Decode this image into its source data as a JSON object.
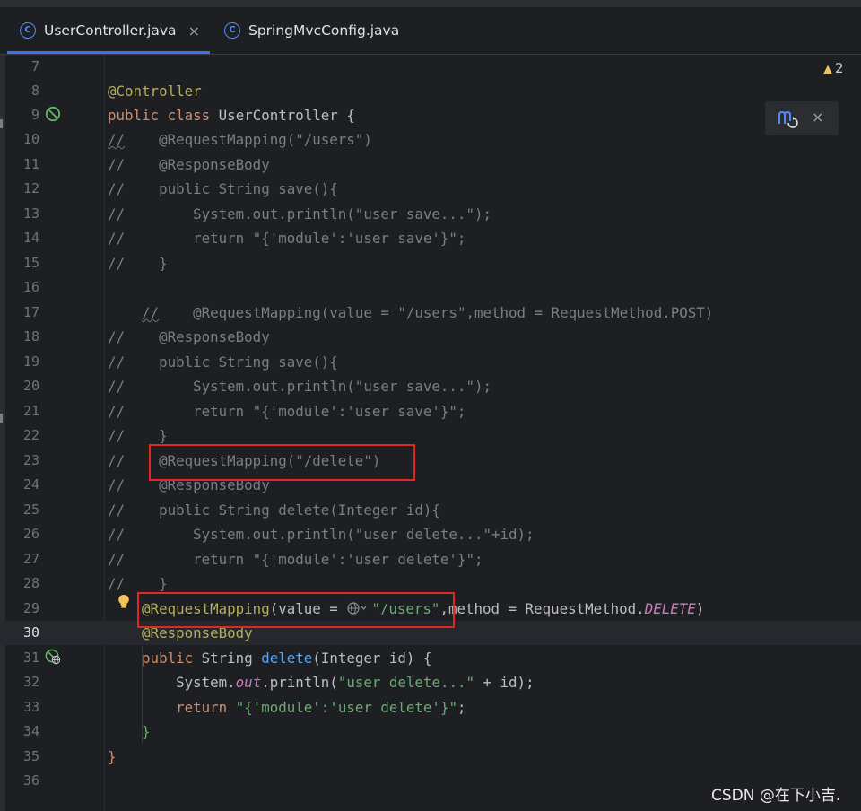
{
  "tabs": [
    {
      "label": "UserController.java",
      "icon": "class-icon",
      "icon_letter": "C",
      "active": true,
      "close_label": "×"
    },
    {
      "label": "SpringMvcConfig.java",
      "icon": "class-icon",
      "icon_letter": "C",
      "active": false
    }
  ],
  "warnings": {
    "icon": "warning-icon",
    "count": "2"
  },
  "maven_popup": {
    "icon": "maven-reload-icon",
    "close_label": "×"
  },
  "gutter_icons": [
    "spring-bean-icon",
    "web-endpoint-icon",
    "intention-bulb-icon"
  ],
  "editor": {
    "current_line": "30",
    "lines": [
      {
        "n": "7",
        "text": ""
      },
      {
        "n": "8",
        "text": "@Controller"
      },
      {
        "n": "9",
        "text": "public class UserController {"
      },
      {
        "n": "10",
        "text": "//    @RequestMapping(\"/users\")"
      },
      {
        "n": "11",
        "text": "//    @ResponseBody"
      },
      {
        "n": "12",
        "text": "//    public String save(){"
      },
      {
        "n": "13",
        "text": "//        System.out.println(\"user save...\");"
      },
      {
        "n": "14",
        "text": "//        return \"{'module':'user save'}\";"
      },
      {
        "n": "15",
        "text": "//    }"
      },
      {
        "n": "16",
        "text": ""
      },
      {
        "n": "17",
        "text": "    //    @RequestMapping(value = \"/users\",method = RequestMethod.POST)"
      },
      {
        "n": "18",
        "text": "//    @ResponseBody"
      },
      {
        "n": "19",
        "text": "//    public String save(){"
      },
      {
        "n": "20",
        "text": "//        System.out.println(\"user save...\");"
      },
      {
        "n": "21",
        "text": "//        return \"{'module':'user save'}\";"
      },
      {
        "n": "22",
        "text": "//    }"
      },
      {
        "n": "23",
        "text": "//    @RequestMapping(\"/delete\")"
      },
      {
        "n": "24",
        "text": "//    @ResponseBody"
      },
      {
        "n": "25",
        "text": "//    public String delete(Integer id){"
      },
      {
        "n": "26",
        "text": "//        System.out.println(\"user delete...\"+id);"
      },
      {
        "n": "27",
        "text": "//        return \"{'module':'user delete'}\";"
      },
      {
        "n": "28",
        "text": "//    }"
      },
      {
        "n": "29",
        "text": "    @RequestMapping(value = \"/users\",method = RequestMethod.DELETE)"
      },
      {
        "n": "30",
        "text": "    @ResponseBody"
      },
      {
        "n": "31",
        "text": "    public String delete(Integer id) {"
      },
      {
        "n": "32",
        "text": "        System.out.println(\"user delete...\" + id);"
      },
      {
        "n": "33",
        "text": "        return \"{'module':'user delete'}\";"
      },
      {
        "n": "34",
        "text": "    }"
      },
      {
        "n": "35",
        "text": "}"
      },
      {
        "n": "36",
        "text": ""
      }
    ]
  },
  "watermark": "CSDN @在下小吉.",
  "colors": {
    "background": "#1e1f22",
    "keyword": "#cf8e6d",
    "annotation": "#b3ae60",
    "string": "#6aab73",
    "comment": "#7a7e85",
    "method": "#56a8f5",
    "static_field": "#c77dbb",
    "accent": "#3574f0",
    "highlight_box": "#e3261f"
  }
}
